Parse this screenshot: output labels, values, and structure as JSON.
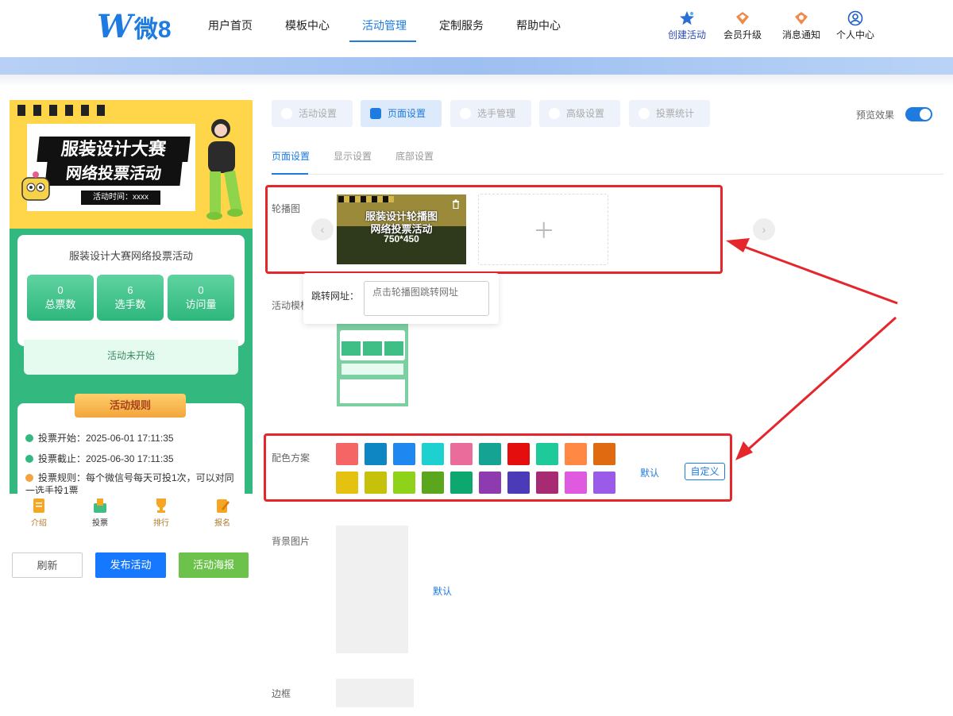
{
  "header": {
    "logo_text": "微8",
    "nav": [
      "用户首页",
      "模板中心",
      "活动管理",
      "定制服务",
      "帮助中心"
    ],
    "active_nav": "活动管理",
    "actions": [
      {
        "label": "创建活动",
        "icon": "star-icon"
      },
      {
        "label": "会员升级",
        "icon": "crown-icon"
      },
      {
        "label": "消息通知",
        "icon": "bell-icon"
      },
      {
        "label": "个人中心",
        "icon": "user-icon"
      }
    ]
  },
  "phone": {
    "banner_title_1": "服装设计大赛",
    "banner_title_2": "网络投票活动",
    "banner_time": "活动时间：xxxx",
    "activity_name": "服装设计大赛网络投票活动",
    "stats": [
      {
        "value": "0",
        "label": "总票数"
      },
      {
        "value": "6",
        "label": "选手数"
      },
      {
        "value": "0",
        "label": "访问量"
      }
    ],
    "status": "活动未开始",
    "rules_title": "活动规则",
    "rules": [
      "投票开始：2025-06-01 17:11:35",
      "投票截止：2025-06-30 17:11:35",
      "投票规则：每个微信号每天可投1次，可以对同一选手投1票"
    ],
    "tabbar": [
      "介绍",
      "投票",
      "排行",
      "报名"
    ]
  },
  "left_buttons": {
    "refresh": "刷新",
    "publish": "发布活动",
    "poster": "活动海报"
  },
  "main_tabs": [
    "活动设置",
    "页面设置",
    "选手管理",
    "高级设置",
    "投票统计"
  ],
  "active_main_tab": "页面设置",
  "preview_label": "预览效果",
  "preview_on": true,
  "sub_tabs": [
    "页面设置",
    "显示设置",
    "底部设置"
  ],
  "active_sub_tab": "页面设置",
  "carousel": {
    "label": "轮播图",
    "image_text": "服装设计轮播图\n网络投票活动",
    "image_size": "750*450"
  },
  "popover": {
    "label": "跳转网址：",
    "placeholder": "点击轮播图跳转网址"
  },
  "template_label": "活动模板",
  "color": {
    "label": "配色方案",
    "swatches": [
      "#f56565",
      "#0f86c4",
      "#1e88f0",
      "#1dd1d1",
      "#e96c9a",
      "#15a394",
      "#e50e0e",
      "#1ec99a",
      "#ff8845",
      "#e06a10",
      "#e5c210",
      "#c6c20a",
      "#8fd21a",
      "#5aa71e",
      "#0da870",
      "#8e3bb0",
      "#4b3bb8",
      "#a82a72",
      "#e05ae0",
      "#9a5ce8"
    ],
    "default_label": "默认",
    "custom_label": "自定义"
  },
  "background": {
    "label": "背景图片",
    "default_label": "默认"
  },
  "border": {
    "label": "边框"
  }
}
